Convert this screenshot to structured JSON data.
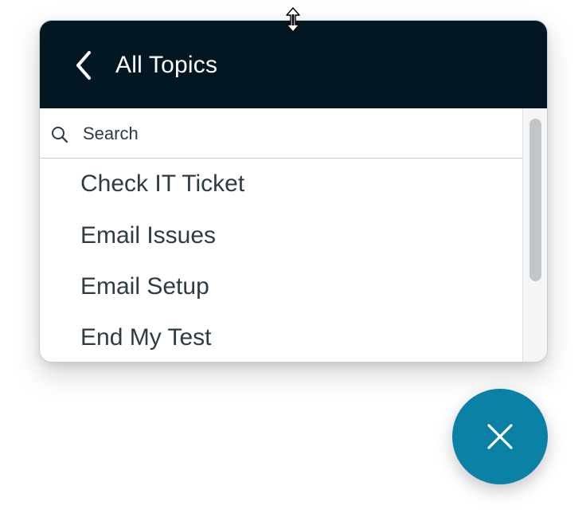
{
  "header": {
    "title": "All Topics",
    "back_icon": "chevron-left-icon"
  },
  "search": {
    "placeholder": "Search",
    "value": "",
    "icon": "search-icon"
  },
  "topics": [
    {
      "label": "Check IT Ticket"
    },
    {
      "label": "Email Issues"
    },
    {
      "label": "Email Setup"
    },
    {
      "label": "End My Test"
    }
  ],
  "colors": {
    "header_bg": "#031722",
    "text": "#2d3b45",
    "fab_bg": "#0a81a5"
  },
  "fab": {
    "icon": "close-icon"
  }
}
